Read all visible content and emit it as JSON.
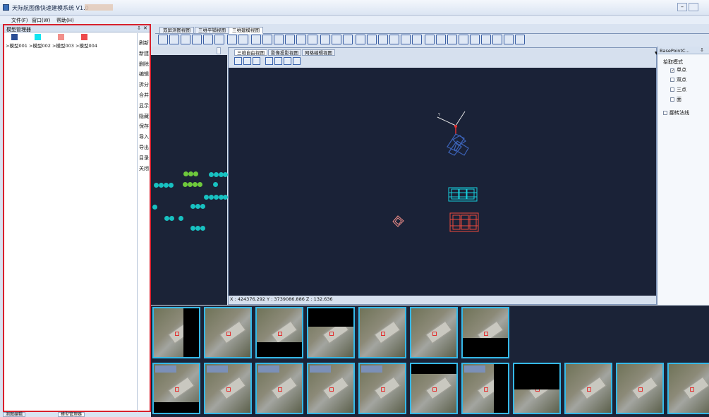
{
  "app": {
    "title": "天际航图像快速建模系统 V1.0"
  },
  "menu": [
    "文件(F)",
    "窗口(W)",
    "帮助(H)"
  ],
  "model_manager": {
    "title": "模型管理器",
    "models": [
      {
        "label": ">模型001",
        "color": "#2b4f96"
      },
      {
        "label": ">模型002",
        "color": "#12e4f0"
      },
      {
        "label": ">模型003",
        "color": "#f28f8a"
      },
      {
        "label": ">模型004",
        "color": "#ee4a4c"
      }
    ],
    "buttons": [
      "刷新",
      "新建",
      "删除",
      "编辑",
      "拆分",
      "合并",
      "显示",
      "隐藏",
      "保存",
      "导入",
      "导出",
      "目录",
      "关闭"
    ]
  },
  "view_tabs": [
    "双屏测图视图",
    "三维平铺视图",
    "三维建模视图"
  ],
  "sub_tabs": [
    "三维自由视图",
    "影像投影视图",
    "网格编辑视图"
  ],
  "coordinates": "X : 424376.292 Y : 3739086.886 Z : 132.636",
  "base_point": {
    "title": "BasePointC...",
    "group_label": "拾取模式",
    "options": [
      {
        "label": "单点",
        "checked": true
      },
      {
        "label": "双点",
        "checked": false
      },
      {
        "label": "三点",
        "checked": false
      },
      {
        "label": "面",
        "checked": false
      }
    ],
    "flip_label": "翻转法线"
  },
  "bottom_tabs": [
    "测图编辑",
    "模型管理器"
  ],
  "colors": {
    "viewport_bg": "#1a2237",
    "highlight_border": "#d8202c",
    "thumb_border": "#35b9e8"
  }
}
